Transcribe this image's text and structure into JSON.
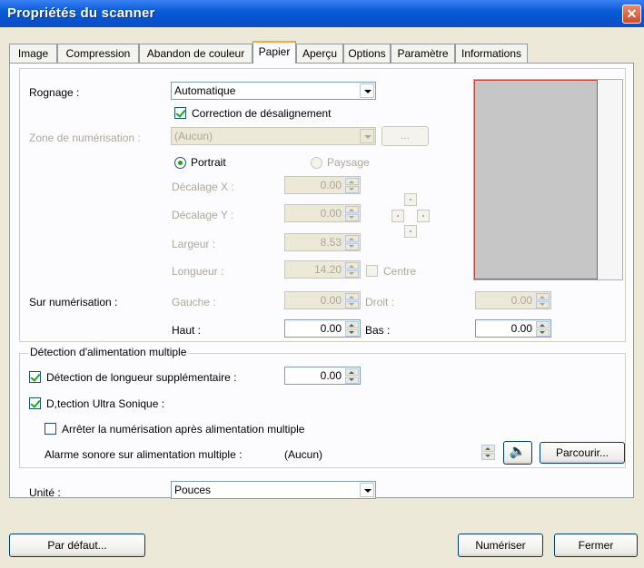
{
  "window": {
    "title": "Propriétés du scanner",
    "close_glyph": "✕"
  },
  "tabs": [
    {
      "label": "Image"
    },
    {
      "label": "Compression"
    },
    {
      "label": "Abandon de couleur"
    },
    {
      "label": "Papier",
      "active": true
    },
    {
      "label": "Aperçu"
    },
    {
      "label": "Options"
    },
    {
      "label": "Paramètre"
    },
    {
      "label": "Informations"
    }
  ],
  "paper": {
    "rognage_label": "Rognage :",
    "rognage_value": "Automatique",
    "correction_label": "Correction de désalignement",
    "correction_checked": true,
    "zone_label": "Zone de numérisation :",
    "zone_value": "(Aucun)",
    "zone_browse": "...",
    "portrait_label": "Portrait",
    "paysage_label": "Paysage",
    "decalage_x_label": "Décalage X :",
    "decalage_x_value": "0.00",
    "decalage_y_label": "Décalage Y :",
    "decalage_y_value": "0.00",
    "largeur_label": "Largeur :",
    "largeur_value": "8.53",
    "longueur_label": "Longueur :",
    "longueur_value": "14.20",
    "centre_label": "Centre",
    "sur_num_label": "Sur numérisation :",
    "gauche_label": "Gauche :",
    "gauche_value": "0.00",
    "droit_label": "Droit :",
    "droit_value": "0.00",
    "haut_label": "Haut :",
    "haut_value": "0.00",
    "bas_label": "Bas :",
    "bas_value": "0.00"
  },
  "multifeed": {
    "group_label": "Détection d'alimentation multiple",
    "longueur_label": "Détection de longueur supplémentaire :",
    "longueur_checked": true,
    "longueur_value": "0.00",
    "ultrasonic_label": "D,tection Ultra Sonique :",
    "ultrasonic_checked": true,
    "stop_label": "Arrêter la numérisation après alimentation multiple",
    "stop_checked": false,
    "alarm_label": "Alarme sonore sur alimentation multiple :",
    "alarm_value": "(Aucun)",
    "speaker_icon": "🔈",
    "browse_label": "Parcourir..."
  },
  "unit": {
    "label": "Unité :",
    "value": "Pouces"
  },
  "buttons": {
    "default_label": "Par défaut...",
    "scan_label": "Numériser",
    "close_label": "Fermer"
  }
}
